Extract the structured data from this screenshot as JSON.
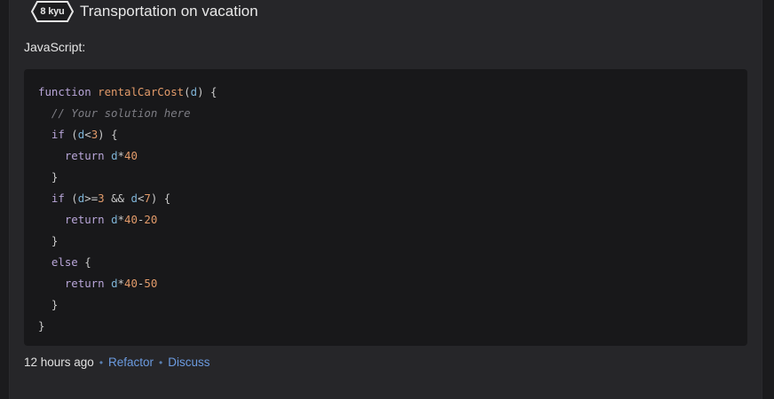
{
  "kata": {
    "rank": "8 kyu",
    "title": "Transportation on vacation"
  },
  "solution": {
    "language_label": "JavaScript:",
    "code_lines": [
      [
        {
          "t": "kw",
          "v": "function "
        },
        {
          "t": "fn",
          "v": "rentalCarCost"
        },
        {
          "t": "pl",
          "v": "("
        },
        {
          "t": "vr",
          "v": "d"
        },
        {
          "t": "pl",
          "v": ") {"
        }
      ],
      [
        {
          "t": "pl",
          "v": "  "
        },
        {
          "t": "cm",
          "v": "// Your solution here"
        }
      ],
      [
        {
          "t": "pl",
          "v": "  "
        },
        {
          "t": "kw",
          "v": "if"
        },
        {
          "t": "pl",
          "v": " ("
        },
        {
          "t": "vr",
          "v": "d"
        },
        {
          "t": "pl",
          "v": "<"
        },
        {
          "t": "nm",
          "v": "3"
        },
        {
          "t": "pl",
          "v": ") {"
        }
      ],
      [
        {
          "t": "pl",
          "v": "    "
        },
        {
          "t": "kw",
          "v": "return "
        },
        {
          "t": "vr",
          "v": "d"
        },
        {
          "t": "pl",
          "v": "*"
        },
        {
          "t": "nm",
          "v": "40"
        }
      ],
      [
        {
          "t": "pl",
          "v": "  }"
        }
      ],
      [
        {
          "t": "pl",
          "v": "  "
        },
        {
          "t": "kw",
          "v": "if"
        },
        {
          "t": "pl",
          "v": " ("
        },
        {
          "t": "vr",
          "v": "d"
        },
        {
          "t": "pl",
          "v": ">="
        },
        {
          "t": "nm",
          "v": "3"
        },
        {
          "t": "pl",
          "v": " && "
        },
        {
          "t": "vr",
          "v": "d"
        },
        {
          "t": "pl",
          "v": "<"
        },
        {
          "t": "nm",
          "v": "7"
        },
        {
          "t": "pl",
          "v": ") {"
        }
      ],
      [
        {
          "t": "pl",
          "v": "    "
        },
        {
          "t": "kw",
          "v": "return "
        },
        {
          "t": "vr",
          "v": "d"
        },
        {
          "t": "pl",
          "v": "*"
        },
        {
          "t": "nm",
          "v": "40"
        },
        {
          "t": "pl",
          "v": "-"
        },
        {
          "t": "nm",
          "v": "20"
        }
      ],
      [
        {
          "t": "pl",
          "v": "  }"
        }
      ],
      [
        {
          "t": "pl",
          "v": "  "
        },
        {
          "t": "kw",
          "v": "else"
        },
        {
          "t": "pl",
          "v": " {"
        }
      ],
      [
        {
          "t": "pl",
          "v": "    "
        },
        {
          "t": "kw",
          "v": "return "
        },
        {
          "t": "vr",
          "v": "d"
        },
        {
          "t": "pl",
          "v": "*"
        },
        {
          "t": "nm",
          "v": "40"
        },
        {
          "t": "pl",
          "v": "-"
        },
        {
          "t": "nm",
          "v": "50"
        }
      ],
      [
        {
          "t": "pl",
          "v": "  }"
        }
      ],
      [
        {
          "t": "pl",
          "v": "}"
        }
      ]
    ]
  },
  "meta": {
    "time_ago": "12 hours ago",
    "separator": "•",
    "refactor_label": "Refactor",
    "discuss_label": "Discuss"
  },
  "colors": {
    "keyword": "#b9a6d9",
    "function_name": "#e39b6a",
    "comment": "#7d7d84",
    "variable": "#7eb3d6",
    "number": "#e39b6a",
    "link": "#6b9be0"
  }
}
